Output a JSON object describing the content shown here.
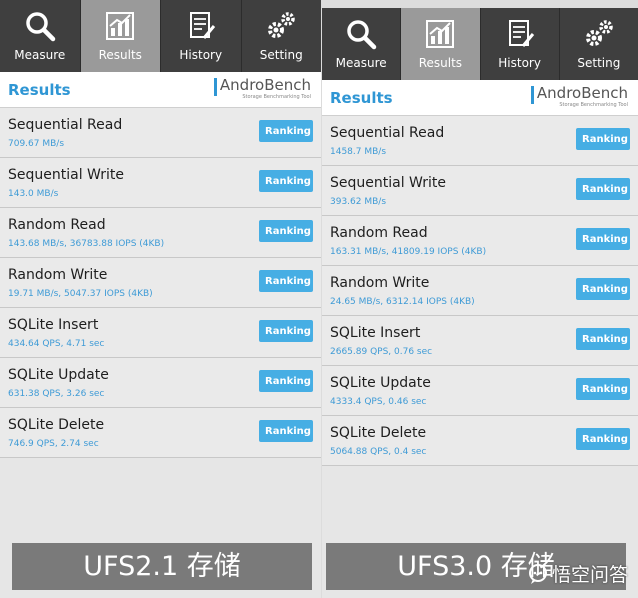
{
  "tabs": [
    {
      "label": "Measure",
      "icon": "search-icon"
    },
    {
      "label": "Results",
      "icon": "bar-chart-icon"
    },
    {
      "label": "History",
      "icon": "document-icon"
    },
    {
      "label": "Setting",
      "icon": "gear-icon"
    }
  ],
  "header": {
    "title": "Results",
    "logo": "AndroBench",
    "logo_sub": "Storage Benchmarking Tool"
  },
  "ranking_label": "Ranking",
  "panels": [
    {
      "caption": "UFS2.1 存储",
      "rows": [
        {
          "label": "Sequential Read",
          "value": "709.67 MB/s"
        },
        {
          "label": "Sequential Write",
          "value": "143.0 MB/s"
        },
        {
          "label": "Random Read",
          "value": "143.68 MB/s, 36783.88 IOPS (4KB)"
        },
        {
          "label": "Random Write",
          "value": "19.71 MB/s, 5047.37 IOPS (4KB)"
        },
        {
          "label": "SQLite Insert",
          "value": "434.64 QPS, 4.71 sec"
        },
        {
          "label": "SQLite Update",
          "value": "631.38 QPS, 3.26 sec"
        },
        {
          "label": "SQLite Delete",
          "value": "746.9 QPS, 2.74 sec"
        }
      ]
    },
    {
      "caption": "UFS3.0 存储",
      "rows": [
        {
          "label": "Sequential Read",
          "value": "1458.7 MB/s"
        },
        {
          "label": "Sequential Write",
          "value": "393.62 MB/s"
        },
        {
          "label": "Random Read",
          "value": "163.31 MB/s, 41809.19 IOPS (4KB)"
        },
        {
          "label": "Random Write",
          "value": "24.65 MB/s, 6312.14 IOPS (4KB)"
        },
        {
          "label": "SQLite Insert",
          "value": "2665.89 QPS, 0.76 sec"
        },
        {
          "label": "SQLite Update",
          "value": "4333.4 QPS, 0.46 sec"
        },
        {
          "label": "SQLite Delete",
          "value": "5064.88 QPS, 0.4 sec"
        }
      ]
    }
  ],
  "watermark": "悟空问答",
  "colors": {
    "accent": "#2f96d4",
    "button": "#46aee4",
    "tabbar": "#3f3f3f",
    "tab_active": "#9a9a9a"
  }
}
